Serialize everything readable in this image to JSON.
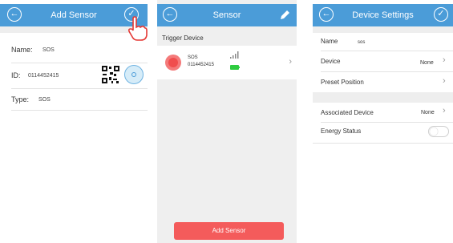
{
  "screens": {
    "add_sensor": {
      "title": "Add Sensor",
      "name_label": "Name:",
      "name_value": "SOS",
      "id_label": "ID:",
      "id_value": "0114452415",
      "type_label": "Type:",
      "type_value": "SOS"
    },
    "sensor": {
      "title": "Sensor",
      "section_label": "Trigger Device",
      "device_name": "SOS",
      "device_id": "0114452415",
      "add_button": "Add Sensor"
    },
    "device_settings": {
      "title": "Device Settings",
      "name_label": "Name",
      "name_value": "sos",
      "device_label": "Device",
      "device_value": "None",
      "preset_label": "Preset Position",
      "associated_label": "Associated Device",
      "associated_value": "None",
      "energy_label": "Energy Status"
    }
  },
  "colors": {
    "header": "#4b9cd8",
    "alert": "#f45b5b",
    "battery": "#2ecc40"
  },
  "icons": [
    "back-icon",
    "check-icon",
    "edit-icon",
    "qr-code-icon",
    "scan-icon",
    "chevron-right-icon",
    "signal-icon",
    "battery-icon",
    "hand-cursor-icon"
  ]
}
